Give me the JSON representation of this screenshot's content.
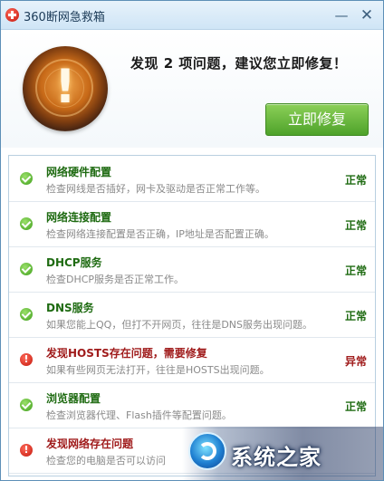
{
  "window": {
    "title": "360断网急救箱",
    "minimize_glyph": "—",
    "close_glyph": "✕"
  },
  "header": {
    "emblem_glyph": "!",
    "headline": "发现 2 项问题，建议您立即修复！",
    "repair_button": "立即修复"
  },
  "items": [
    {
      "status": "ok",
      "title": "网络硬件配置",
      "desc": "检查网线是否插好，网卡及驱动是否正常工作等。",
      "status_text": "正常"
    },
    {
      "status": "ok",
      "title": "网络连接配置",
      "desc": "检查网络连接配置是否正确，IP地址是否配置正确。",
      "status_text": "正常"
    },
    {
      "status": "ok",
      "title": "DHCP服务",
      "desc": "检查DHCP服务是否正常工作。",
      "status_text": "正常"
    },
    {
      "status": "ok",
      "title": "DNS服务",
      "desc": "如果您能上QQ，但打不开网页，往往是DNS服务出现问题。",
      "status_text": "正常"
    },
    {
      "status": "error",
      "title": "发现HOSTS存在问题，需要修复",
      "desc": "如果有些网页无法打开，往往是HOSTS出现问题。",
      "status_text": "异常"
    },
    {
      "status": "ok",
      "title": "浏览器配置",
      "desc": "检查浏览器代理、Flash插件等配置问题。",
      "status_text": "正常"
    },
    {
      "status": "error",
      "title": "发现网络存在问题",
      "desc": "检查您的电脑是否可以访问",
      "status_text": ""
    }
  ],
  "watermark": {
    "text": "系统之家"
  },
  "colors": {
    "ok_green": "#1f6b12",
    "error_red": "#a01c1c",
    "button_green": "#4ea22a"
  }
}
